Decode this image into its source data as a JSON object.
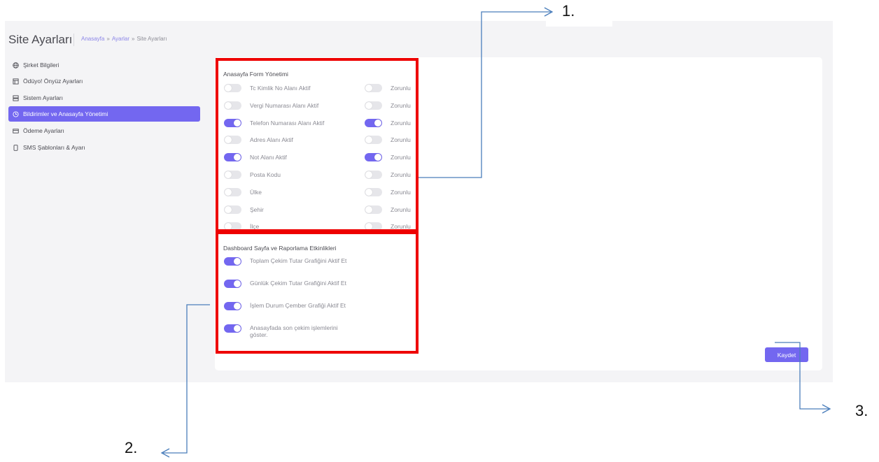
{
  "header": {
    "title": "Site Ayarları",
    "breadcrumb": [
      "Anasayfa",
      "Ayarlar",
      "Site Ayarları"
    ],
    "breadcrumb_sep": "»"
  },
  "sidebar": {
    "items": [
      {
        "label": "Şirket Bilgileri",
        "icon": "globe-icon",
        "active": false
      },
      {
        "label": "Ödüyo! Önyüz Ayarları",
        "icon": "layout-icon",
        "active": false
      },
      {
        "label": "Sistem Ayarları",
        "icon": "server-icon",
        "active": false
      },
      {
        "label": "Bildirimler ve Anasayfa Yönetimi",
        "icon": "clock-icon",
        "active": true
      },
      {
        "label": "Ödeme Ayarları",
        "icon": "credit-card-icon",
        "active": false
      },
      {
        "label": "SMS Şablonları & Ayarı",
        "icon": "phone-icon",
        "active": false
      }
    ]
  },
  "form_section": {
    "title": "Anasayfa Form Yönetimi",
    "rows": [
      {
        "label": "Tc Kimlik No Alanı Aktif",
        "active": false,
        "required_label": "Zorunlu",
        "required": false
      },
      {
        "label": "Vergi Numarası Alanı Aktif",
        "active": false,
        "required_label": "Zorunlu",
        "required": false
      },
      {
        "label": "Telefon Numarası Alanı Aktif",
        "active": true,
        "required_label": "Zorunlu",
        "required": true
      },
      {
        "label": "Adres Alanı Aktif",
        "active": false,
        "required_label": "Zorunlu",
        "required": false
      },
      {
        "label": "Not Alanı Aktif",
        "active": true,
        "required_label": "Zorunlu",
        "required": true
      },
      {
        "label": "Posta Kodu",
        "active": false,
        "required_label": "Zorunlu",
        "required": false
      },
      {
        "label": "Ülke",
        "active": false,
        "required_label": "Zorunlu",
        "required": false
      },
      {
        "label": "Şehir",
        "active": false,
        "required_label": "Zorunlu",
        "required": false
      },
      {
        "label": "İlçe",
        "active": false,
        "required_label": "Zorunlu",
        "required": false
      }
    ]
  },
  "dashboard_section": {
    "title": "Dashboard Sayfa ve Raporlama Etkinlikleri",
    "rows": [
      {
        "label": "Toplam Çekim Tutar Grafiğini Aktif Et",
        "active": true
      },
      {
        "label": "Günlük Çekim Tutar Grafiğini Aktif Et",
        "active": true
      },
      {
        "label": "İşlem Durum Çember Grafiği Aktif Et",
        "active": true
      },
      {
        "label": "Anasayfada son çekim işlemlerini göster.",
        "active": true
      }
    ]
  },
  "save_label": "Kaydet",
  "annotations": [
    "1.",
    "2.",
    "3."
  ],
  "colors": {
    "accent": "#7367f0",
    "highlight": "#ee0000",
    "arrow": "#4a7ebb"
  }
}
